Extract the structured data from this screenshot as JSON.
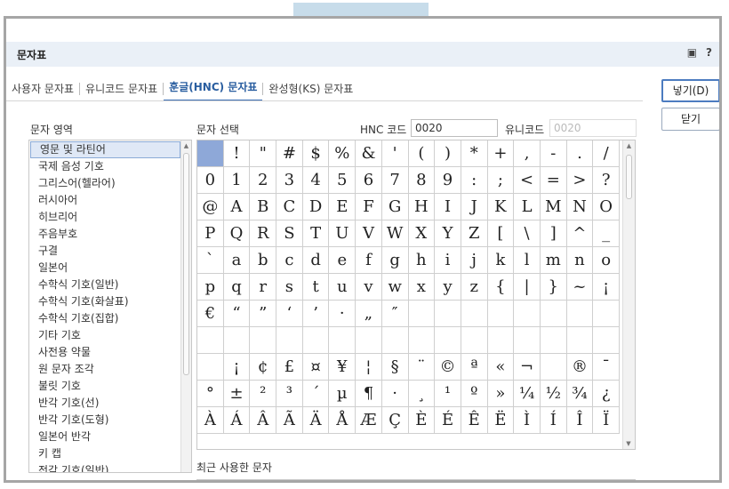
{
  "dialog": {
    "title": "문자표",
    "icons": [
      "window-icon",
      "help-icon"
    ],
    "help_glyph": "?",
    "window_glyph": "▣"
  },
  "tabs": [
    {
      "label": "사용자 문자표",
      "active": false
    },
    {
      "label": "유니코드 문자표",
      "active": false
    },
    {
      "label": "훈글(HNC) 문자표",
      "active": true
    },
    {
      "label": "완성형(KS) 문자표",
      "active": false
    }
  ],
  "buttons": {
    "insert": "넣기(D)",
    "close": "닫기"
  },
  "area": {
    "label": "문자 영역",
    "items": [
      "영문 및 라틴어",
      "국제 음성 기호",
      "그리스어(헬라어)",
      "러시아어",
      "히브리어",
      "주음부호",
      "구결",
      "일본어",
      "수학식 기호(일반)",
      "수학식 기호(화살표)",
      "수학식 기호(집합)",
      "기타 기호",
      "사전용 약물",
      "원 문자 조각",
      "불릿 기호",
      "반각 기호(선)",
      "반각 기호(도형)",
      "일본어 반각",
      "키 캡",
      "전각 기호(일반)"
    ],
    "selected_index": 0
  },
  "char_select": {
    "label": "문자 선택",
    "hnc_label": "HNC 코드",
    "hnc_value": "0020",
    "unicode_label": "유니코드",
    "unicode_value": "0020"
  },
  "recent": {
    "label": "최근 사용한 문자"
  },
  "chars": [
    " ",
    "!",
    "\"",
    "#",
    "$",
    "%",
    "&",
    "'",
    "(",
    ")",
    "*",
    "+",
    ",",
    "-",
    ".",
    "/",
    "0",
    "1",
    "2",
    "3",
    "4",
    "5",
    "6",
    "7",
    "8",
    "9",
    ":",
    ";",
    "<",
    "=",
    ">",
    "?",
    "@",
    "A",
    "B",
    "C",
    "D",
    "E",
    "F",
    "G",
    "H",
    "I",
    "J",
    "K",
    "L",
    "M",
    "N",
    "O",
    "P",
    "Q",
    "R",
    "S",
    "T",
    "U",
    "V",
    "W",
    "X",
    "Y",
    "Z",
    "[",
    "\\",
    "]",
    "^",
    "_",
    "`",
    "a",
    "b",
    "c",
    "d",
    "e",
    "f",
    "g",
    "h",
    "i",
    "j",
    "k",
    "l",
    "m",
    "n",
    "o",
    "p",
    "q",
    "r",
    "s",
    "t",
    "u",
    "v",
    "w",
    "x",
    "y",
    "z",
    "{",
    "|",
    "}",
    "~",
    "¡",
    "€",
    "“",
    "”",
    "‘",
    "’",
    "·",
    "„",
    "″",
    "",
    "",
    "",
    "",
    "",
    "",
    "",
    "",
    "",
    "",
    "",
    "",
    "",
    "",
    "",
    "",
    "",
    "",
    "",
    "",
    "",
    "",
    "",
    "",
    "",
    "¡",
    "¢",
    "£",
    "¤",
    "¥",
    "¦",
    "§",
    "¨",
    "©",
    "ª",
    "«",
    "¬",
    "",
    "®",
    "¯",
    "°",
    "±",
    "²",
    "³",
    "´",
    "µ",
    "¶",
    "·",
    "¸",
    "¹",
    "º",
    "»",
    "¼",
    "½",
    "¾",
    "¿",
    "À",
    "Á",
    "Â",
    "Ã",
    "Ä",
    "Å",
    "Æ",
    "Ç",
    "È",
    "É",
    "Ê",
    "Ë",
    "Ì",
    "Í",
    "Î",
    "Ï"
  ]
}
